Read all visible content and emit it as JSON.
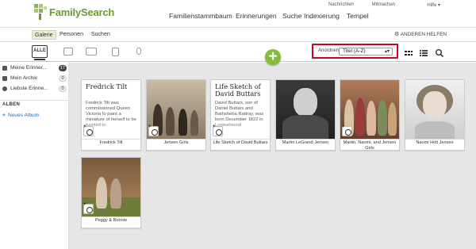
{
  "app": {
    "logo_text": "FamilySearch",
    "brand_color": "#6e9a2a"
  },
  "top_links": [
    "Nachrichten",
    "Mitmachen",
    "Hilfe ▾"
  ],
  "main_nav": [
    "Familienstammbaum",
    "Erinnerungen",
    "Suche",
    "Indexierung",
    "Tempel"
  ],
  "sub_nav": {
    "tabs": [
      "Galerie",
      "Personen",
      "Suchen"
    ],
    "active_tab": "Galerie",
    "help_others": "ANDEREN HELFEN"
  },
  "filter_bar": {
    "all_label": "ALLE",
    "sort_label": "Anordnen:",
    "sort_value": "Titel (A-Z)",
    "highlight_color": "#d0021b",
    "add_color": "#87bc36"
  },
  "sidebar": {
    "items": [
      {
        "label": "Meine Erinner...",
        "count": "17",
        "icon": "grid-icon"
      },
      {
        "label": "Mein Archiv",
        "count": "0",
        "icon": "archive-icon"
      },
      {
        "label": "Liebste Erinne...",
        "count": "0",
        "icon": "heart-icon"
      }
    ],
    "albums_heading": "ALBEN",
    "new_album": "Neues Album"
  },
  "gallery": {
    "cards": [
      {
        "type": "story",
        "title": "Fredrick Tilt",
        "excerpt": "Fredrick Tilt was commissioned Queen Victoria to paint a miniature of herself to be painted to",
        "caption": "Fredrick Tilt"
      },
      {
        "type": "photo",
        "caption": "Jensen Girls"
      },
      {
        "type": "story",
        "title": "Life Sketch of David Buttars",
        "excerpt": "David Buttars, son of Daniel Buttars and Bathsheba Rattray, was born December 1822 in Logiealmond",
        "caption": "Life Sketch of David Buttars"
      },
      {
        "type": "photo",
        "caption": "Martin LeGrand Jensen"
      },
      {
        "type": "photo",
        "caption": "Martin, Naomi, and Jensen Girls"
      },
      {
        "type": "photo",
        "caption": "Naomi Holt Jensen"
      },
      {
        "type": "photo",
        "caption": "Peggy & Bonnie"
      }
    ]
  }
}
